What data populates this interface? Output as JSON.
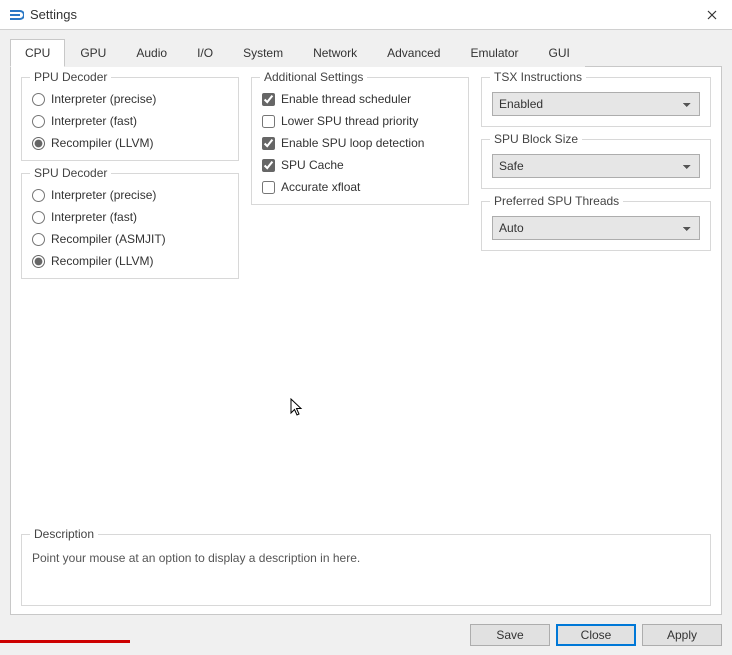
{
  "window": {
    "title": "Settings"
  },
  "tabs": [
    "CPU",
    "GPU",
    "Audio",
    "I/O",
    "System",
    "Network",
    "Advanced",
    "Emulator",
    "GUI"
  ],
  "active_tab": 0,
  "ppu": {
    "legend": "PPU Decoder",
    "options": [
      "Interpreter (precise)",
      "Interpreter (fast)",
      "Recompiler (LLVM)"
    ],
    "selected": 2
  },
  "spu": {
    "legend": "SPU Decoder",
    "options": [
      "Interpreter (precise)",
      "Interpreter (fast)",
      "Recompiler (ASMJIT)",
      "Recompiler (LLVM)"
    ],
    "selected": 3
  },
  "additional": {
    "legend": "Additional Settings",
    "options": [
      {
        "label": "Enable thread scheduler",
        "checked": true
      },
      {
        "label": "Lower SPU thread priority",
        "checked": false
      },
      {
        "label": "Enable SPU loop detection",
        "checked": true
      },
      {
        "label": "SPU Cache",
        "checked": true
      },
      {
        "label": "Accurate xfloat",
        "checked": false
      }
    ]
  },
  "tsx": {
    "legend": "TSX Instructions",
    "value": "Enabled"
  },
  "blocksize": {
    "legend": "SPU Block Size",
    "value": "Safe"
  },
  "sputhreads": {
    "legend": "Preferred SPU Threads",
    "value": "Auto"
  },
  "description": {
    "legend": "Description",
    "text": "Point your mouse at an option to display a description in here."
  },
  "buttons": {
    "save": "Save",
    "close": "Close",
    "apply": "Apply"
  }
}
